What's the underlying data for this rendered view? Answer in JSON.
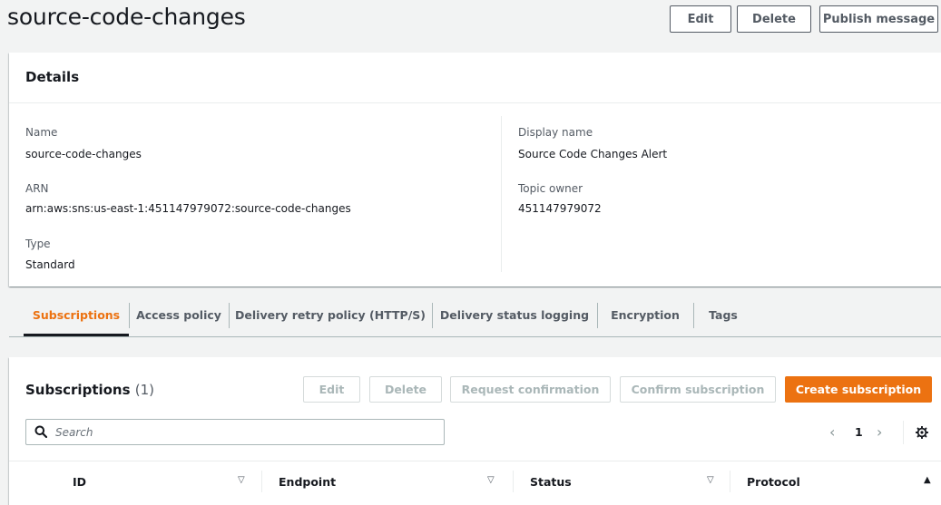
{
  "header": {
    "title": "source-code-changes",
    "edit_label": "Edit",
    "delete_label": "Delete",
    "publish_label": "Publish message"
  },
  "details": {
    "title": "Details",
    "name_label": "Name",
    "name_value": "source-code-changes",
    "arn_label": "ARN",
    "arn_value": "arn:aws:sns:us-east-1:451147979072:source-code-changes",
    "type_label": "Type",
    "type_value": "Standard",
    "display_name_label": "Display name",
    "display_name_value": "Source Code Changes Alert",
    "topic_owner_label": "Topic owner",
    "topic_owner_value": "451147979072"
  },
  "tabs": [
    {
      "label": "Subscriptions",
      "active": true
    },
    {
      "label": "Access policy",
      "active": false
    },
    {
      "label": "Delivery retry policy (HTTP/S)",
      "active": false
    },
    {
      "label": "Delivery status logging",
      "active": false
    },
    {
      "label": "Encryption",
      "active": false
    },
    {
      "label": "Tags",
      "active": false
    }
  ],
  "subscriptions": {
    "title": "Subscriptions",
    "count": "(1)",
    "edit_label": "Edit",
    "delete_label": "Delete",
    "request_confirmation_label": "Request confirmation",
    "confirm_subscription_label": "Confirm subscription",
    "create_subscription_label": "Create subscription",
    "search_placeholder": "Search",
    "page_number": "1",
    "columns": [
      "ID",
      "Endpoint",
      "Status",
      "Protocol"
    ]
  },
  "icons": {
    "search": "search-icon",
    "gear": "gear-icon",
    "prev": "chevron-left-icon",
    "next": "chevron-right-icon",
    "sort_down": "sort-down-icon",
    "sort_up": "sort-up-icon"
  },
  "colors": {
    "accent": "#ec7211",
    "text": "#16191f",
    "muted": "#545b64",
    "background": "#f2f3f3"
  }
}
